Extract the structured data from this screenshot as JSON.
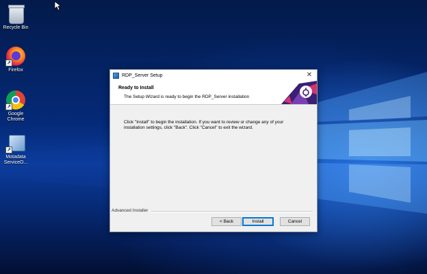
{
  "desktop": {
    "icons": [
      {
        "label": "Recycle Bin",
        "icon": "recycle-bin-icon"
      },
      {
        "label": "Firefox",
        "icon": "firefox-icon"
      },
      {
        "label": "Google Chrome",
        "icon": "chrome-icon"
      },
      {
        "label": "Motadata ServiceO...",
        "icon": "installer-icon"
      }
    ]
  },
  "dialog": {
    "title": "RDP_Server Setup",
    "close_glyph": "✕",
    "header_title": "Ready to Install",
    "header_subtitle": "The Setup Wizard is ready to begin the RDP_Server installation",
    "body": "Click \"Install\" to begin the installation.  If you want to review or change any of your installation settings, click \"Back\".  Click \"Cancel\" to exit the wizard.",
    "branding": "Advanced Installer",
    "buttons": {
      "back": "< Back",
      "install": "Install",
      "cancel": "Cancel"
    }
  },
  "colors": {
    "accent": "#0078d7",
    "banner_purple": "#3b1f73",
    "banner_pink": "#d6336c"
  }
}
